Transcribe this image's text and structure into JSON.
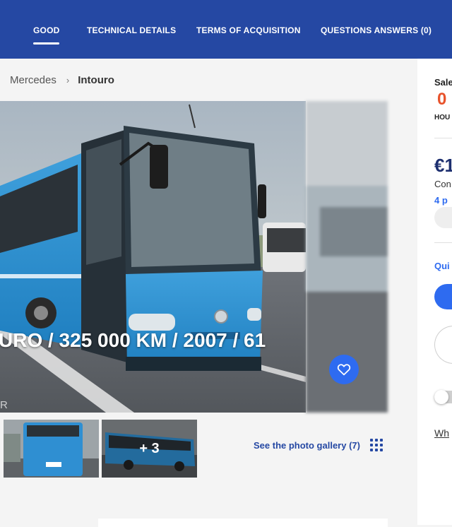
{
  "nav": {
    "tabs": [
      {
        "label": "GOOD",
        "active": true
      },
      {
        "label": "TECHNICAL DETAILS"
      },
      {
        "label": "TERMS OF ACQUISITION"
      },
      {
        "label": "QUESTIONS ANSWERS (0)"
      }
    ]
  },
  "breadcrumb": {
    "parent": "Mercedes",
    "separator": "›",
    "current": "Intouro"
  },
  "photo": {
    "caption": "URO / 325 000 KM / 2007 / 61",
    "watermark": "R",
    "favorite_icon": "heart-icon"
  },
  "thumbnails": {
    "more_label": "+ 3"
  },
  "gallery": {
    "link_label": "See the photo gallery (7)",
    "icon": "grid-icon"
  },
  "sidebar": {
    "sale_label": "Sale",
    "countdown": "0",
    "hours_label": "HOU",
    "price": "€1",
    "text1": "Con",
    "text2": "4 p",
    "quick_label": "Qui",
    "link_label": "Wh"
  },
  "colors": {
    "brand": "#2548a3",
    "accent": "#2e6bf0",
    "countdown": "#e8532c",
    "price": "#1d2f6f"
  }
}
